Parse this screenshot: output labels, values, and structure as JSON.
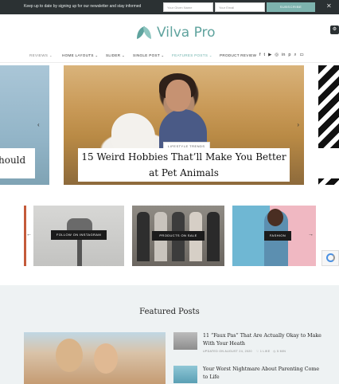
{
  "newsletter": {
    "message": "Keep up to date by signing up for our newsletter and stay informed",
    "name_placeholder": "Your Given Name",
    "email_placeholder": "Your Email",
    "subscribe_label": "SUBSCRIBE",
    "close_icon": "close-icon"
  },
  "brand": {
    "name": "Vilva Pro",
    "color": "#5fa39e"
  },
  "nav": {
    "items": [
      "REVIEWS",
      "HOME LAYOUTS",
      "SLIDER",
      "SINGLE POST",
      "FEATURES POSTS",
      "PRODUCT REVIEW"
    ],
    "icons": [
      "facebook-icon",
      "twitter-icon",
      "youtube-icon",
      "instagram-icon",
      "linkedin-icon",
      "pinterest-icon",
      "search-icon",
      "cart-icon"
    ]
  },
  "slider": {
    "left_title_fragment": "hould",
    "main_category": "LIFESTYLE TRENDS",
    "main_title": "15 Weird Hobbies That’ll Make You Better at Pet Animals"
  },
  "promos": [
    {
      "label": "FOLLOW ON INSTAGRAM"
    },
    {
      "label": "PRODUCTS ON SALE"
    },
    {
      "label": "FASHION"
    }
  ],
  "featured": {
    "heading": "Featured Posts",
    "posts": [
      {
        "title": "11 “Faux Pas” That Are Actually Okay to Make With Your Heath",
        "date": "UPDATED ON AUGUST 24, 2020",
        "likes": "1 LIKE",
        "reading": "5 MIN"
      },
      {
        "title": "Your Worst Nightmare About Parenting Come to Life"
      }
    ]
  }
}
